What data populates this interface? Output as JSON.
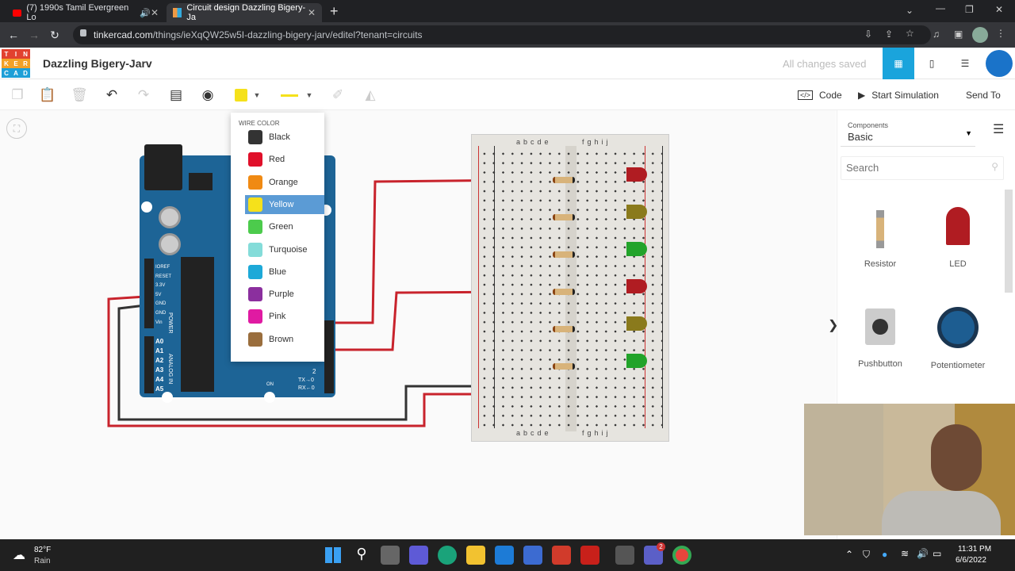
{
  "browser": {
    "tabs": [
      {
        "label": "(7) 1990s Tamil Evergreen Lo",
        "icon": "youtube-icon"
      },
      {
        "label": "Circuit design Dazzling Bigery-Ja",
        "icon": "tinkercad-icon"
      }
    ],
    "url_host": "tinkercad.com",
    "url_path": "/things/ieXqQW25w5I-dazzling-bigery-jarv/editel?tenant=circuits"
  },
  "app": {
    "logo_letters": [
      "T",
      "I",
      "N",
      "K",
      "E",
      "R",
      "C",
      "A",
      "D"
    ],
    "title": "Dazzling Bigery-Jarv",
    "save_status": "All changes saved",
    "code_label": "Code",
    "simulate_label": "Start Simulation",
    "send_label": "Send To"
  },
  "wire_menu": {
    "heading": "WIRE COLOR",
    "selected": "Yellow",
    "colors": [
      {
        "name": "Black",
        "hex": "#333333"
      },
      {
        "name": "Red",
        "hex": "#e0102a"
      },
      {
        "name": "Orange",
        "hex": "#f08a13"
      },
      {
        "name": "Yellow",
        "hex": "#f5e11b"
      },
      {
        "name": "Green",
        "hex": "#4ccb4c"
      },
      {
        "name": "Turquoise",
        "hex": "#84dcd9"
      },
      {
        "name": "Blue",
        "hex": "#1da9d8"
      },
      {
        "name": "Purple",
        "hex": "#8b2f9e"
      },
      {
        "name": "Pink",
        "hex": "#e01aa2"
      },
      {
        "name": "Brown",
        "hex": "#9a6e3d"
      }
    ]
  },
  "panel": {
    "components_label": "Components",
    "components_value": "Basic",
    "search_placeholder": "Search",
    "items": [
      "Resistor",
      "LED",
      "Pushbutton",
      "Potentiometer"
    ]
  },
  "arduino": {
    "power_pins": [
      "IOREF",
      "RESET",
      "3.3V",
      "5V",
      "GND",
      "GND",
      "Vin"
    ],
    "analog_pins": [
      "A0",
      "A1",
      "A2",
      "A3",
      "A4",
      "A5"
    ],
    "power_label": "POWER",
    "analog_label": "ANALOG IN",
    "tx": "TX→0",
    "rx": "RX←0",
    "pin2": "2",
    "on": "ON"
  },
  "breadboard": {
    "cols_left": [
      "a",
      "b",
      "c",
      "d",
      "e"
    ],
    "cols_right": [
      "f",
      "g",
      "h",
      "i",
      "j"
    ],
    "rows": 30
  },
  "taskbar": {
    "temp": "82°F",
    "weather": "Rain",
    "time": "11:31 PM",
    "date": "6/6/2022",
    "badge": "2"
  }
}
